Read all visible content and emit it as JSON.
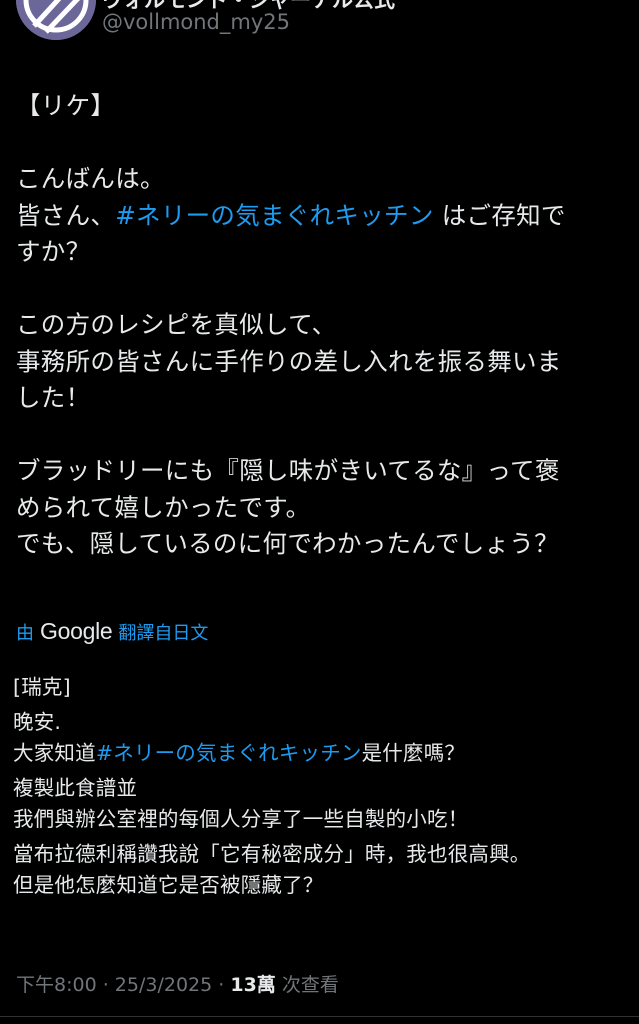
{
  "author": {
    "display_name": "ヴォルモンド・ジャーナル公式",
    "handle": "@vollmond_my25",
    "avatar_icon": "moon-emblem-icon"
  },
  "original": {
    "lines": [
      {
        "text": "【リケ】"
      },
      {
        "blank": true
      },
      {
        "text": "こんばんは。"
      },
      {
        "pre": "皆さん、",
        "tag": "#ネリーの気まぐれキッチン",
        "post": " はご存知で"
      },
      {
        "text": "すか？"
      },
      {
        "blank": true
      },
      {
        "text": "この方のレシピを真似して、"
      },
      {
        "text": "事務所の皆さんに手作りの差し入れを振る舞いま"
      },
      {
        "text": "した！"
      },
      {
        "blank": true
      },
      {
        "text": "ブラッドリーにも『隠し味がきいてるな』って褒"
      },
      {
        "text": "められて嬉しかったです。"
      },
      {
        "text": "でも、隠しているのに何でわかったんでしょう？"
      }
    ]
  },
  "translation_bar": {
    "prefix": "由",
    "google": "Google",
    "suffix": "翻譯自日文"
  },
  "translation": {
    "paragraphs": [
      {
        "lines": [
          {
            "text": "[瑞克]"
          }
        ]
      },
      {
        "lines": [
          {
            "text": "晚安."
          },
          {
            "pre": "大家知道",
            "tag": "#ネリーの気まぐれキッチン",
            "post": "是什麼嗎？"
          }
        ]
      },
      {
        "lines": [
          {
            "text": "複製此食譜並"
          },
          {
            "text": "我們與辦公室裡的每個人分享了一些自製的小吃！"
          }
        ]
      },
      {
        "lines": [
          {
            "text": "當布拉德利稱讚我說「它有秘密成分」時，我也很高興。"
          },
          {
            "text": "但是他怎麼知道它是否被隱藏了？"
          }
        ]
      }
    ]
  },
  "meta": {
    "time": "下午8:00",
    "sep1": " · ",
    "date": "25/3/2025",
    "sep2": " · ",
    "views": "13萬",
    "views_label": " 次查看"
  },
  "colors": {
    "background": "#000000",
    "text": "#e7e9ea",
    "link": "#1d9bf0",
    "muted": "#71767b"
  }
}
